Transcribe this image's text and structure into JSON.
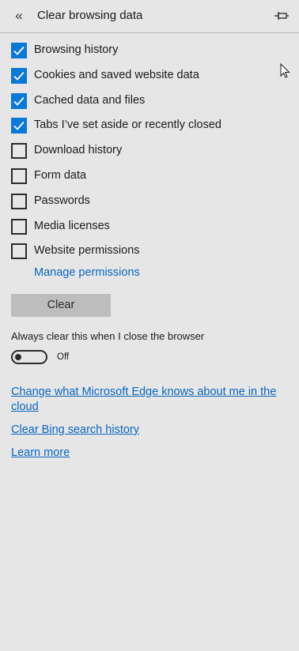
{
  "header": {
    "back_icon": "double-chevron-left-icon",
    "title": "Clear browsing data",
    "pin_icon": "pin-icon"
  },
  "options": [
    {
      "label": "Browsing history",
      "checked": true
    },
    {
      "label": "Cookies and saved website data",
      "checked": true
    },
    {
      "label": "Cached data and files",
      "checked": true
    },
    {
      "label": "Tabs I’ve set aside or recently closed",
      "checked": true
    },
    {
      "label": "Download history",
      "checked": false
    },
    {
      "label": "Form data",
      "checked": false
    },
    {
      "label": "Passwords",
      "checked": false
    },
    {
      "label": "Media licenses",
      "checked": false
    },
    {
      "label": "Website permissions",
      "checked": false
    }
  ],
  "manage_permissions_link": "Manage permissions",
  "clear_button": "Clear",
  "always_clear": {
    "label": "Always clear this when I close the browser",
    "toggle_state": "Off"
  },
  "links": {
    "change_cloud": "Change what Microsoft Edge knows about me in the cloud",
    "clear_bing": "Clear Bing search history",
    "learn_more": "Learn more"
  },
  "colors": {
    "accent": "#0a78d7",
    "link": "#0a66c2",
    "panel_bg": "#e6e6e6",
    "button_bg": "#bdbdbd"
  }
}
